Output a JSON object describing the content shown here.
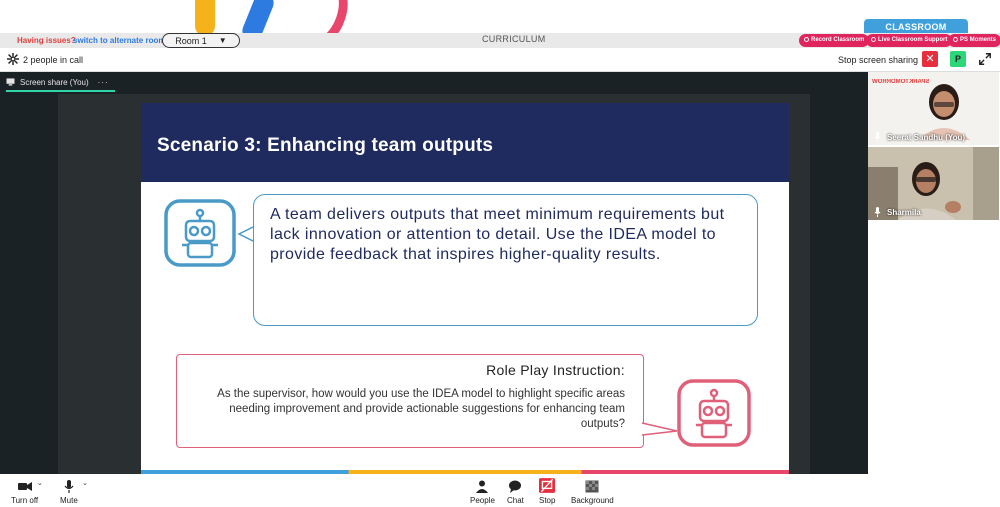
{
  "brand": {
    "classroom_badge": "CLASSROOM",
    "accent_yellow": "#f5b21b",
    "accent_blue": "#2d7be0",
    "accent_red": "#e8466a"
  },
  "info_bar": {
    "issues_text": "Having issues?",
    "issues_link": "switch to alternate room",
    "room_value": "Room 1",
    "curriculum_label": "CURRICULUM",
    "pills": [
      "Record Classroom",
      "Live Classroom Support",
      "PS Moments"
    ]
  },
  "call_header": {
    "people_count": "2 people in call",
    "stop_sharing_label": "Stop screen sharing",
    "participant_badge": "P"
  },
  "main": {
    "tab_label": "Screen share (You)",
    "tab_menu": "···"
  },
  "slide": {
    "title": "Scenario 3:  Enhancing team outputs",
    "blue_bubble_text": "A team delivers outputs that meet minimum requirements but lack innovation or attention to detail. Use the IDEA model to provide feedback that inspires higher-quality results.",
    "role_title": "Role Play Instruction:",
    "role_text": "As the supervisor, how would you use the IDEA model to highlight specific areas needing improvement and provide actionable suggestions for enhancing team outputs?",
    "header_color": "#1f2a5e",
    "blue_color": "#4a9ac7",
    "red_color": "#e0607a"
  },
  "participants": [
    {
      "name": "Seerat Sandhu (You)",
      "brand_text": "SPARKTOMORROW"
    },
    {
      "name": "Sharmila"
    }
  ],
  "toolbar": {
    "turn_off": "Turn off",
    "mute": "Mute",
    "people": "People",
    "chat": "Chat",
    "stop": "Stop",
    "background": "Background"
  }
}
